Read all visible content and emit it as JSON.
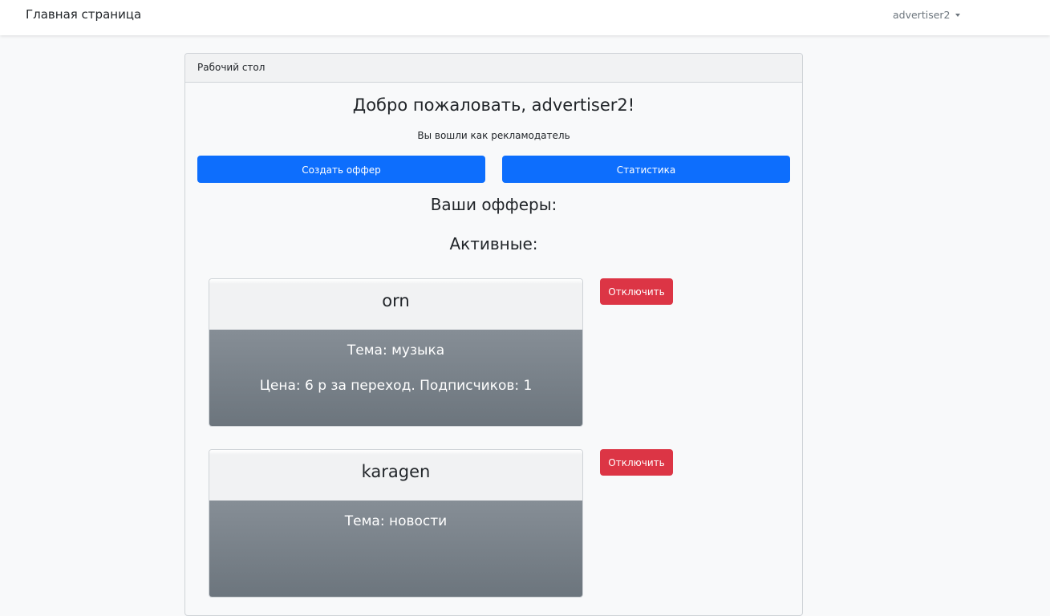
{
  "navbar": {
    "brand": "Главная страница",
    "user": "advertiser2"
  },
  "dashboard": {
    "header": "Рабочий стол",
    "welcome": "Добро пожаловать, advertiser2!",
    "role_text": "Вы вошли как рекламодатель",
    "create_offer_label": "Создать оффер",
    "stats_label": "Статистика",
    "offers_title": "Ваши офферы:",
    "active_title": "Активные:"
  },
  "offers": [
    {
      "name": "orn",
      "topic": "Тема: музыка",
      "price": "Цена: 6 р за переход. Подписчиков: 1",
      "action_label": "Отключить"
    },
    {
      "name": "karagen",
      "topic": "Тема: новости",
      "price": "",
      "action_label": "Отключить"
    }
  ],
  "colors": {
    "primary": "#0d6efd",
    "danger": "#dc3545",
    "card_body": "#6c757d"
  }
}
